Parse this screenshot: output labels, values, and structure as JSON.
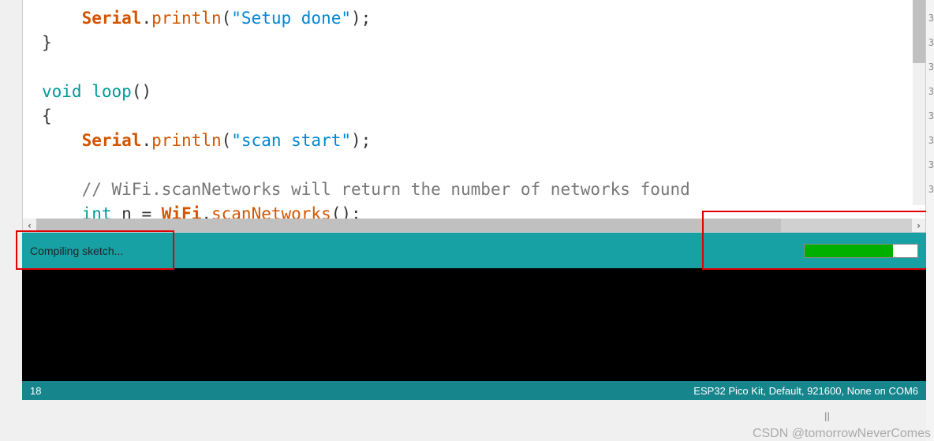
{
  "code": {
    "line1_indent": "    ",
    "line1_obj": "Serial",
    "line1_dot": ".",
    "line1_method": "println",
    "line1_paren_open": "(",
    "line1_str": "\"Setup done\"",
    "line1_paren_close": ")",
    "line1_semi": ";",
    "line2": "}",
    "line3": "",
    "line4_kw": "void",
    "line4_space": " ",
    "line4_name": "loop",
    "line4_parens": "()",
    "line5": "{",
    "line6_indent": "    ",
    "line6_obj": "Serial",
    "line6_dot": ".",
    "line6_method": "println",
    "line6_paren_open": "(",
    "line6_str": "\"scan start\"",
    "line6_paren_close": ")",
    "line6_semi": ";",
    "line7": "",
    "line8_indent": "    ",
    "line8_comment": "// WiFi.scanNetworks will return the number of networks found",
    "line9_indent": "    ",
    "line9_type": "int",
    "line9_space1": " ",
    "line9_var": "n",
    "line9_eq": " = ",
    "line9_obj": "WiFi",
    "line9_dot": ".",
    "line9_method": "scanNetworks",
    "line9_parens": "()",
    "line9_semi": ";"
  },
  "status": {
    "message": "Compiling sketch...",
    "progress_percent": 78
  },
  "footer": {
    "line_number": "18",
    "board_info": "ESP32 Pico Kit, Default, 921600, None on COM6"
  },
  "gutter": {
    "n1": "3",
    "n2": "3",
    "n3": "3",
    "n4": "3",
    "n5": "3",
    "n6": "3",
    "n7": "3",
    "n8": "3"
  },
  "watermark": {
    "ll": "ll",
    "text": "CSDN @tomorrowNeverComes"
  },
  "scroll": {
    "left_arrow": "‹",
    "right_arrow": "›"
  }
}
